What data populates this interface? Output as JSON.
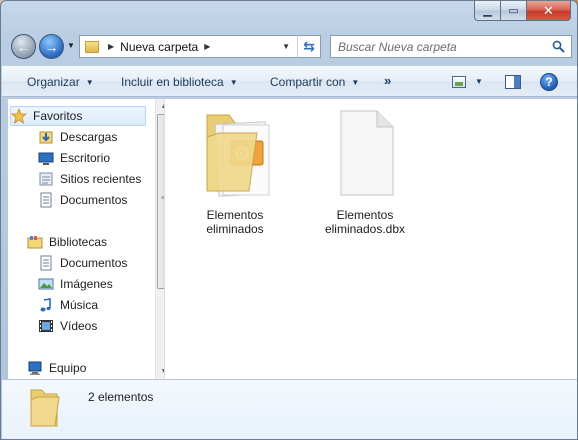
{
  "window": {
    "controls": {
      "minimize": "▁",
      "maximize": "▭",
      "close": "✕"
    }
  },
  "address": {
    "path": "Nueva carpeta",
    "search_placeholder": "Buscar Nueva carpeta"
  },
  "toolbar": {
    "organize": "Organizar",
    "include": "Incluir en biblioteca",
    "share": "Compartir con",
    "more": "»"
  },
  "sidebar": {
    "favorites": "Favoritos",
    "favorites_items": [
      "Descargas",
      "Escritorio",
      "Sitios recientes",
      "Documentos"
    ],
    "libraries": "Bibliotecas",
    "libraries_items": [
      "Documentos",
      "Imágenes",
      "Música",
      "Vídeos"
    ],
    "computer": "Equipo"
  },
  "files": [
    {
      "name_line1": "Elementos",
      "name_line2": "eliminados",
      "icon": "outlook-folder-icon"
    },
    {
      "name_line1": "Elementos",
      "name_line2": "eliminados.dbx",
      "icon": "blank-file-icon"
    }
  ],
  "status": {
    "count": "2 elementos"
  },
  "colors": {
    "accent": "#2e6fc6",
    "selection": "#dcebfc"
  }
}
